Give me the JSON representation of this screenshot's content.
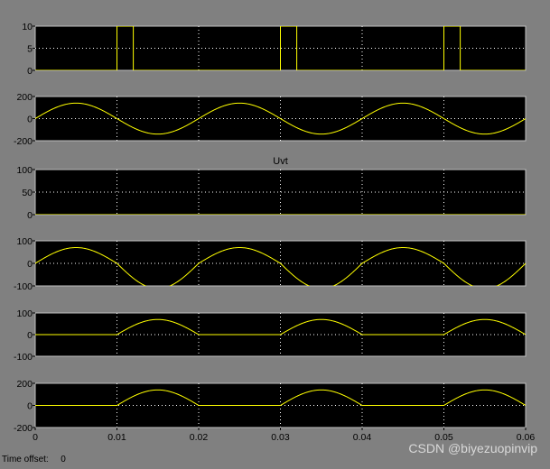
{
  "window": {
    "time_offset_label": "Time offset:",
    "time_offset_value": "0",
    "watermark": "CSDN @biyezuopinvip"
  },
  "colors": {
    "figure_bg": "#808080",
    "axes_bg": "#000000",
    "trace": "#ffff00",
    "grid": "#ffffff"
  },
  "chart_data": [
    {
      "type": "line",
      "title": "",
      "xlim": [
        0,
        0.06
      ],
      "ylim": [
        0,
        10
      ],
      "yticks": [
        0,
        5,
        10
      ],
      "grid": true,
      "signal": "pulse",
      "pulse_starts": [
        0.01,
        0.03,
        0.05
      ],
      "pulse_width": 0.002,
      "pulse_height": 10,
      "show_xticklabels": false
    },
    {
      "type": "line",
      "title": "",
      "xlim": [
        0,
        0.06
      ],
      "ylim": [
        -200,
        200
      ],
      "yticks": [
        -200,
        0,
        200
      ],
      "grid": true,
      "signal": "sine",
      "amplitude": 140,
      "frequency_hz": 50,
      "show_xticklabels": false
    },
    {
      "type": "line",
      "title": "Uvt",
      "xlim": [
        0,
        0.06
      ],
      "ylim": [
        0,
        100
      ],
      "yticks": [
        0,
        50,
        100
      ],
      "grid": true,
      "signal": "zero",
      "show_xticklabels": false
    },
    {
      "type": "line",
      "title": "",
      "xlim": [
        0,
        0.06
      ],
      "ylim": [
        -100,
        100
      ],
      "yticks": [
        -100,
        0,
        100
      ],
      "grid": true,
      "signal": "sine_clipped",
      "amplitude": 70,
      "frequency_hz": 50,
      "phase_shift_s": 0.0,
      "show_xticklabels": false
    },
    {
      "type": "line",
      "title": "",
      "xlim": [
        0,
        0.06
      ],
      "ylim": [
        -100,
        100
      ],
      "yticks": [
        -100,
        0,
        100
      ],
      "grid": true,
      "signal": "half_wave_negative",
      "amplitude": 70,
      "frequency_hz": 50,
      "show_xticklabels": false
    },
    {
      "type": "line",
      "title": "",
      "xlim": [
        0,
        0.06
      ],
      "ylim": [
        -200,
        200
      ],
      "yticks": [
        -200,
        0,
        200
      ],
      "grid": true,
      "signal": "half_wave_negative",
      "amplitude": 140,
      "frequency_hz": 50,
      "xticks": [
        0,
        0.01,
        0.02,
        0.03,
        0.04,
        0.05,
        0.06
      ],
      "xticklabels": [
        "0",
        "0.01",
        "0.02",
        "0.03",
        "0.04",
        "0.05",
        "0.06"
      ],
      "show_xticklabels": true
    }
  ]
}
